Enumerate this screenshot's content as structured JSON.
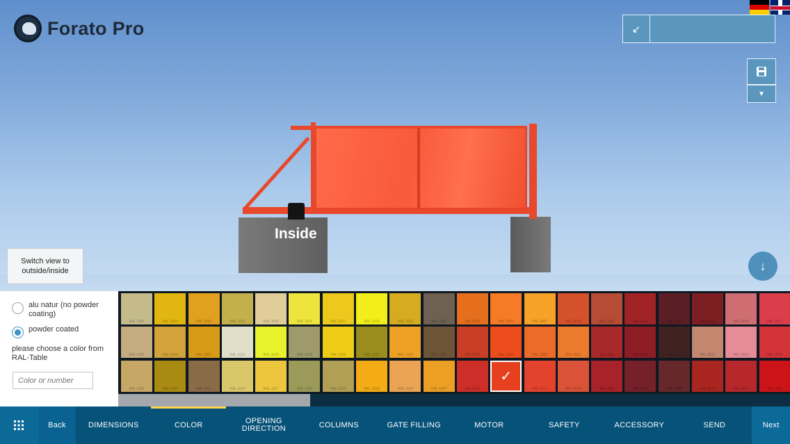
{
  "brand": {
    "name": "Forato Pro",
    "logo_icon": "bird-logo-icon"
  },
  "languages": [
    "german-flag-icon",
    "uk-flag-icon"
  ],
  "viewport": {
    "inside_label": "Inside",
    "switch_view_label": "Switch view to outside/inside",
    "gate_color": "#f85a3a"
  },
  "color_options": {
    "option_natur": "alu natur (no powder coating)",
    "option_powder": "powder coated",
    "selected": "powder coated",
    "hint": "please choose a color from RAL-Table",
    "search_placeholder": "Color or number"
  },
  "swatches": [
    {
      "code": "RAL 1000",
      "hex": "#c5bb8a"
    },
    {
      "code": "RAL 1003",
      "hex": "#e2b611"
    },
    {
      "code": "RAL 1006",
      "hex": "#e1a11e"
    },
    {
      "code": "RAL 1012",
      "hex": "#c3af4b"
    },
    {
      "code": "RAL 1015",
      "hex": "#e0cd9a"
    },
    {
      "code": "RAL 1016",
      "hex": "#ede43d"
    },
    {
      "code": "RAL 1021",
      "hex": "#ecc91c"
    },
    {
      "code": "RAL 1026",
      "hex": "#f2ee1a"
    },
    {
      "code": "RAL 1032",
      "hex": "#d5ac1f"
    },
    {
      "code": "RAL 1035",
      "hex": "#6e6151"
    },
    {
      "code": "RAL 2000",
      "hex": "#e66f1d"
    },
    {
      "code": "RAL 2003",
      "hex": "#f77b27"
    },
    {
      "code": "RAL 2007",
      "hex": "#f6a128"
    },
    {
      "code": "RAL 2010",
      "hex": "#d4512b"
    },
    {
      "code": "RAL 3000",
      "hex": "#b64c34"
    },
    {
      "code": "RAL 3002",
      "hex": "#a02426"
    },
    {
      "code": "RAL 3005",
      "hex": "#5b1e24"
    },
    {
      "code": "RAL 3011",
      "hex": "#7d1f22"
    },
    {
      "code": "RAL 3014",
      "hex": "#ce6d72"
    },
    {
      "code": "RAL 3017",
      "hex": "#dc3d4a"
    },
    {
      "code": "RAL 1001",
      "hex": "#c4ac80"
    },
    {
      "code": "RAL 1004",
      "hex": "#d2a33a"
    },
    {
      "code": "RAL 1007",
      "hex": "#d89b18"
    },
    {
      "code": "RAL 1013",
      "hex": "#e1dfca"
    },
    {
      "code": "RAL 1018",
      "hex": "#e9f02c"
    },
    {
      "code": "RAL 1019",
      "hex": "#9e9a6c"
    },
    {
      "code": "RAL 1023",
      "hex": "#efcc16"
    },
    {
      "code": "RAL 1027",
      "hex": "#9a8d1e"
    },
    {
      "code": "RAL 1033",
      "hex": "#eda225"
    },
    {
      "code": "RAL 1036",
      "hex": "#6f5537"
    },
    {
      "code": "RAL 2001",
      "hex": "#c83e27"
    },
    {
      "code": "RAL 2004",
      "hex": "#ed4d1d"
    },
    {
      "code": "RAL 2008",
      "hex": "#ed6b28"
    },
    {
      "code": "RAL 2011",
      "hex": "#ea7b2c"
    },
    {
      "code": "RAL 3001",
      "hex": "#a9292a"
    },
    {
      "code": "RAL 3003",
      "hex": "#8e1c25"
    },
    {
      "code": "RAL 3007",
      "hex": "#402321"
    },
    {
      "code": "RAL 3012",
      "hex": "#c3866e"
    },
    {
      "code": "RAL 3015",
      "hex": "#e58c98"
    },
    {
      "code": "RAL 3018",
      "hex": "#d23438"
    },
    {
      "code": "RAL 1002",
      "hex": "#c7a765"
    },
    {
      "code": "RAL 1005",
      "hex": "#a98a12"
    },
    {
      "code": "RAL 1011",
      "hex": "#8a6b48"
    },
    {
      "code": "RAL 1014",
      "hex": "#dac769"
    },
    {
      "code": "RAL 1017",
      "hex": "#eec63d"
    },
    {
      "code": "RAL 1020",
      "hex": "#9c9a59"
    },
    {
      "code": "RAL 1024",
      "hex": "#b19f55"
    },
    {
      "code": "RAL 1028",
      "hex": "#f4ac16"
    },
    {
      "code": "RAL 1034",
      "hex": "#eaa454"
    },
    {
      "code": "RAL 1037",
      "hex": "#eb9f24"
    },
    {
      "code": "RAL 2002",
      "hex": "#cc2f28"
    },
    {
      "code": "RAL 2009",
      "hex": "#e7401f"
    },
    {
      "code": "RAL 2012",
      "hex": "#e3432d"
    },
    {
      "code": "RAL 2013",
      "hex": "#da5237"
    },
    {
      "code": "RAL 3000",
      "hex": "#a72329"
    },
    {
      "code": "RAL 3004",
      "hex": "#76202a"
    },
    {
      "code": "RAL 3009",
      "hex": "#66282a"
    },
    {
      "code": "RAL 3013",
      "hex": "#a8261f"
    },
    {
      "code": "RAL 3016",
      "hex": "#b6282c"
    },
    {
      "code": "RAL 3020",
      "hex": "#cc1418"
    }
  ],
  "selected_swatch_index": 51,
  "selected_icon": "checkmark-icon",
  "nav": {
    "menu_icon": "grid-menu-icon",
    "back": "Back",
    "next": "Next",
    "items": [
      "DIMENSIONS",
      "COLOR",
      "OPENING DIRECTION",
      "COLUMNS",
      "GATE FILLING",
      "MOTOR",
      "SAFETY",
      "ACCESSORY",
      "SEND"
    ],
    "active": "COLOR"
  }
}
